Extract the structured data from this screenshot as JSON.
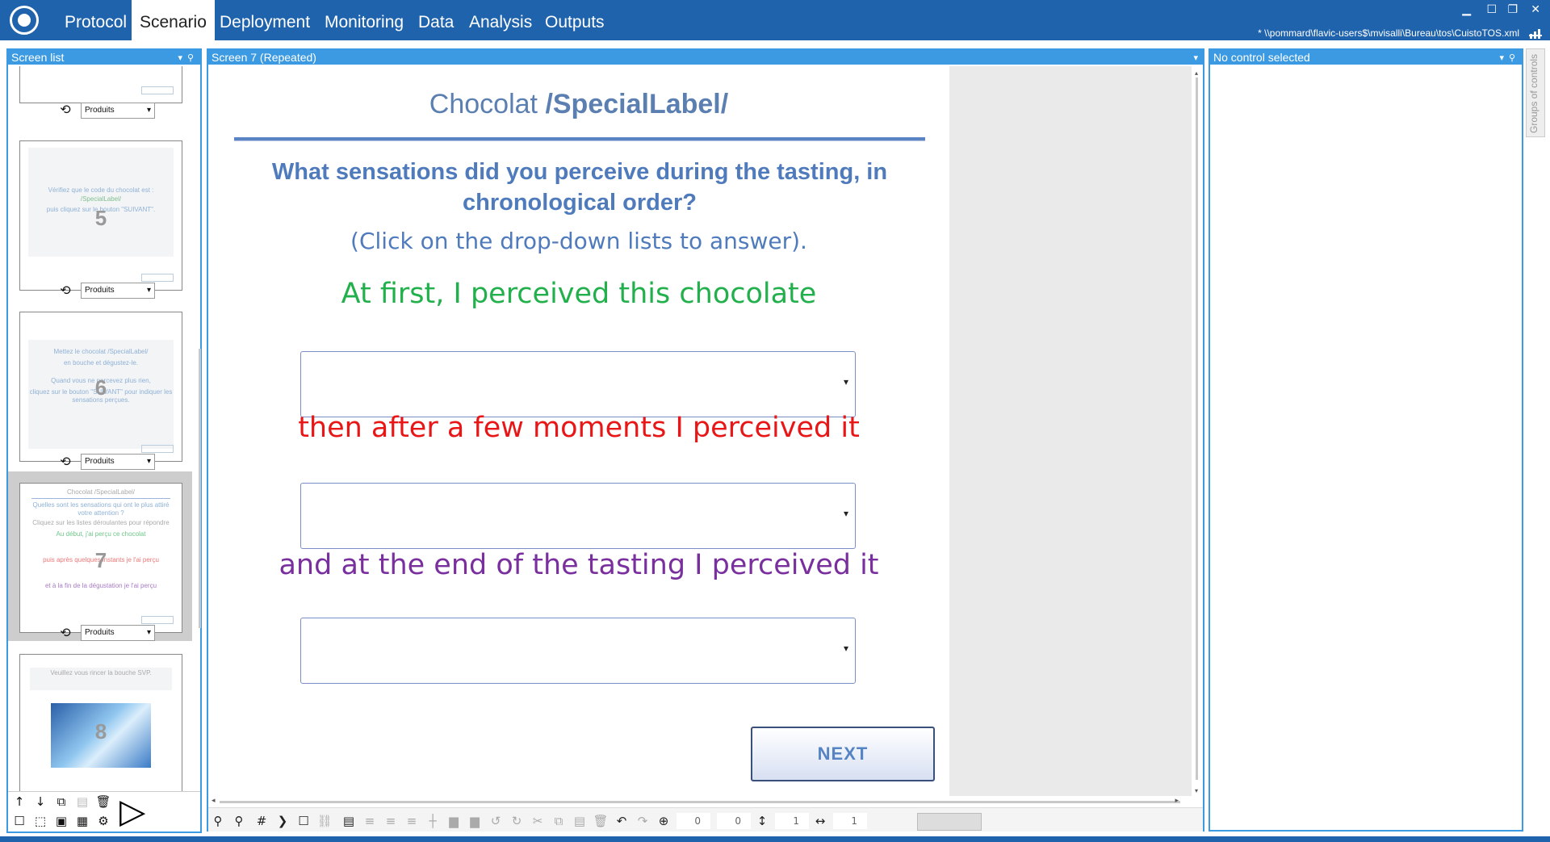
{
  "menu": {
    "tabs": [
      "Protocol",
      "Scenario",
      "Deployment",
      "Monitoring",
      "Data",
      "Analysis",
      "Outputs"
    ],
    "active": "Scenario",
    "file_path": "* \\\\pommard\\flavic-users$\\mvisalli\\Bureau\\tos\\CuistoTOS.xml"
  },
  "screen_list": {
    "header": "Screen list",
    "thumbnails": [
      {
        "number": "",
        "product": "Produits",
        "lines": []
      },
      {
        "number": "5",
        "product": "Produits",
        "lines": [
          "Vérifiez que le code du chocolat est :",
          "/SpecialLabel/",
          "puis cliquez sur le bouton \"SUIVANT\"."
        ]
      },
      {
        "number": "6",
        "product": "Produits",
        "lines": [
          "Mettez le chocolat /SpecialLabel/",
          "en bouche et dégustez-le.",
          "Quand vous ne percevez plus rien,",
          "cliquez sur le bouton \"SUIVANT\" pour indiquer les sensations perçues."
        ]
      },
      {
        "number": "7",
        "product": "Produits",
        "lines": [
          "Chocolat /SpecialLabel/",
          "Quelles sont les sensations qui ont le plus attiré votre attention ?",
          "Cliquez sur les listes déroulantes pour répondre",
          "Au début, j'ai perçu ce chocolat",
          "puis après quelques instants je l'ai perçu",
          "et à la fin de la dégustation je l'ai perçu"
        ]
      },
      {
        "number": "8",
        "product": "",
        "lines": [
          "Veuillez vous rincer la bouche SVP."
        ]
      }
    ]
  },
  "editor": {
    "header": "Screen 7 (Repeated)",
    "title_prefix": "Chocolat ",
    "title_label": "/SpecialLabel/",
    "question": "What sensations did you perceive during the tasting, in chronological order?",
    "hint": "(Click on the drop-down lists to answer).",
    "label_first": "At first, I perceived this chocolate",
    "label_then": "then after a few moments I perceived it",
    "label_end": "and at the end of the tasting I perceived it",
    "next_button": "NEXT",
    "colors": {
      "first": "#22b04c",
      "then": "#e81616",
      "end": "#7a2f9e"
    }
  },
  "properties": {
    "header": "No control selected",
    "side_tab": "Groups of controls"
  },
  "toolbar": {
    "x_value": "0",
    "y_value": "0",
    "w_value": "1",
    "h_value": "1"
  }
}
